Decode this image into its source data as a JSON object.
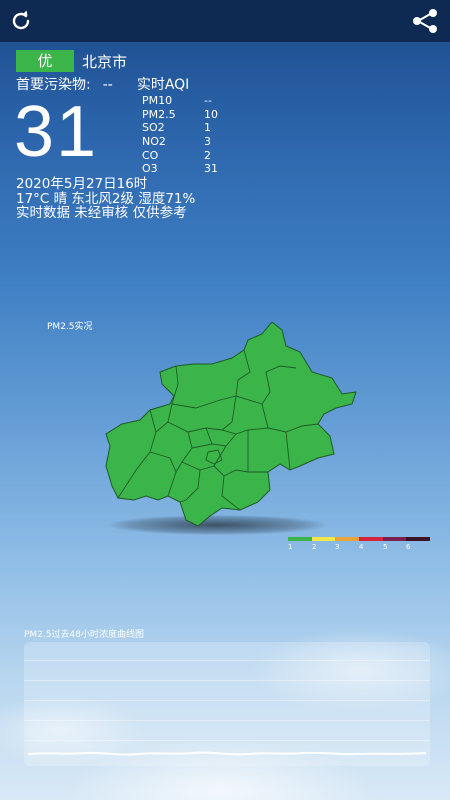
{
  "header": {
    "refresh_icon": "refresh-icon",
    "share_icon": "share-icon"
  },
  "summary": {
    "level": "优",
    "level_color": "#3bb54a",
    "city": "北京市",
    "primary_pollutant_label": "首要污染物:",
    "primary_pollutant_value": "--",
    "aqi_label": "实时AQI",
    "aqi_value": "31"
  },
  "pollutants": [
    {
      "name": "PM10",
      "value": "--"
    },
    {
      "name": "PM2.5",
      "value": "10"
    },
    {
      "name": "SO2",
      "value": "1"
    },
    {
      "name": "NO2",
      "value": "3"
    },
    {
      "name": "CO",
      "value": "2"
    },
    {
      "name": "O3",
      "value": "31"
    }
  ],
  "weather": {
    "datetime": "2020年5月27日16时",
    "conditions": "17°C  晴   东北风2级  湿度71%",
    "disclaimer": "实时数据 未经审核 仅供参考"
  },
  "map": {
    "label": "PM2.5实况",
    "fill_color": "#3bb54a"
  },
  "legend": {
    "labels": [
      "1",
      "2",
      "3",
      "4",
      "5",
      "6"
    ],
    "colors": [
      "#3bb54a",
      "#f2e84a",
      "#e8a33a",
      "#d6243a",
      "#7a2150",
      "#3a1424"
    ]
  },
  "curve": {
    "title": "PM2.5过去48小时浓度曲线图"
  }
}
